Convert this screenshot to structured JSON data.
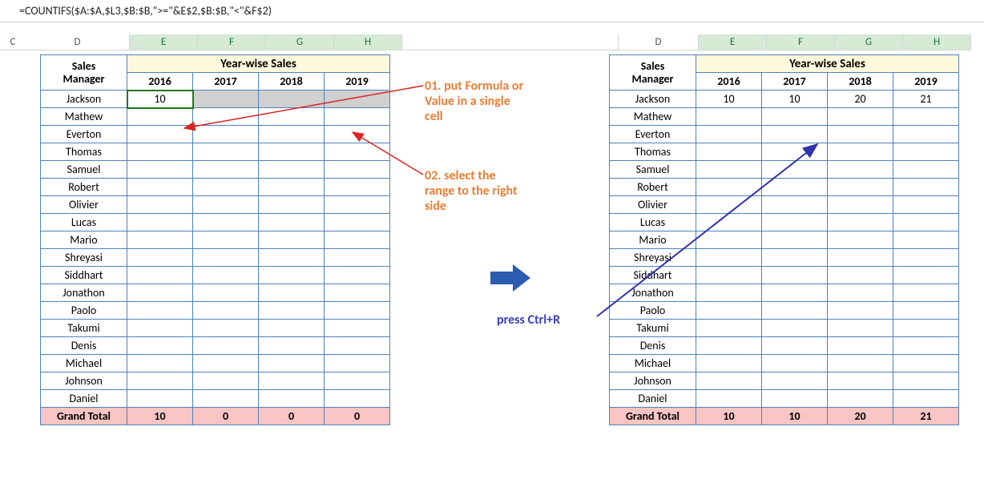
{
  "formula": "=COUNTIFS($A:$A,$L3,$B:$B,\">=\"&E$2,$B:$B,\"<\"&F$2)",
  "colHeaders": {
    "left": [
      "C",
      "D",
      "E",
      "F",
      "G",
      "H"
    ],
    "right": [
      "D",
      "E",
      "F",
      "G",
      "H"
    ]
  },
  "leftTable": {
    "yearHeader": "Year-wise Sales",
    "mgrHeader1": "Sales",
    "mgrHeader2": "Manager",
    "years": [
      "2016",
      "2017",
      "2018",
      "2019"
    ],
    "rows": [
      {
        "name": "Jackson",
        "vals": [
          "10",
          "",
          "",
          ""
        ],
        "selected": true
      },
      {
        "name": "Mathew",
        "vals": [
          "",
          "",
          "",
          ""
        ]
      },
      {
        "name": "Everton",
        "vals": [
          "",
          "",
          "",
          ""
        ]
      },
      {
        "name": "Thomas",
        "vals": [
          "",
          "",
          "",
          ""
        ]
      },
      {
        "name": "Samuel",
        "vals": [
          "",
          "",
          "",
          ""
        ]
      },
      {
        "name": "Robert",
        "vals": [
          "",
          "",
          "",
          ""
        ]
      },
      {
        "name": "Olivier",
        "vals": [
          "",
          "",
          "",
          ""
        ]
      },
      {
        "name": "Lucas",
        "vals": [
          "",
          "",
          "",
          ""
        ]
      },
      {
        "name": "Mario",
        "vals": [
          "",
          "",
          "",
          ""
        ]
      },
      {
        "name": "Shreyasi",
        "vals": [
          "",
          "",
          "",
          ""
        ]
      },
      {
        "name": "Siddhart",
        "vals": [
          "",
          "",
          "",
          ""
        ]
      },
      {
        "name": "Jonathon",
        "vals": [
          "",
          "",
          "",
          ""
        ]
      },
      {
        "name": "Paolo",
        "vals": [
          "",
          "",
          "",
          ""
        ]
      },
      {
        "name": "Takumi",
        "vals": [
          "",
          "",
          "",
          ""
        ]
      },
      {
        "name": "Denis",
        "vals": [
          "",
          "",
          "",
          ""
        ]
      },
      {
        "name": "Michael",
        "vals": [
          "",
          "",
          "",
          ""
        ]
      },
      {
        "name": "Johnson",
        "vals": [
          "",
          "",
          "",
          ""
        ]
      },
      {
        "name": "Daniel",
        "vals": [
          "",
          "",
          "",
          ""
        ]
      }
    ],
    "grandTotal": {
      "label": "Grand Total",
      "vals": [
        "10",
        "0",
        "0",
        "0"
      ]
    }
  },
  "rightTable": {
    "yearHeader": "Year-wise Sales",
    "mgrHeader1": "Sales",
    "mgrHeader2": "Manager",
    "years": [
      "2016",
      "2017",
      "2018",
      "2019"
    ],
    "rows": [
      {
        "name": "Jackson",
        "vals": [
          "10",
          "10",
          "20",
          "21"
        ]
      },
      {
        "name": "Mathew",
        "vals": [
          "",
          "",
          "",
          ""
        ]
      },
      {
        "name": "Everton",
        "vals": [
          "",
          "",
          "",
          ""
        ]
      },
      {
        "name": "Thomas",
        "vals": [
          "",
          "",
          "",
          ""
        ]
      },
      {
        "name": "Samuel",
        "vals": [
          "",
          "",
          "",
          ""
        ]
      },
      {
        "name": "Robert",
        "vals": [
          "",
          "",
          "",
          ""
        ]
      },
      {
        "name": "Olivier",
        "vals": [
          "",
          "",
          "",
          ""
        ]
      },
      {
        "name": "Lucas",
        "vals": [
          "",
          "",
          "",
          ""
        ]
      },
      {
        "name": "Mario",
        "vals": [
          "",
          "",
          "",
          ""
        ]
      },
      {
        "name": "Shreyasi",
        "vals": [
          "",
          "",
          "",
          ""
        ]
      },
      {
        "name": "Siddhart",
        "vals": [
          "",
          "",
          "",
          ""
        ]
      },
      {
        "name": "Jonathon",
        "vals": [
          "",
          "",
          "",
          ""
        ]
      },
      {
        "name": "Paolo",
        "vals": [
          "",
          "",
          "",
          ""
        ]
      },
      {
        "name": "Takumi",
        "vals": [
          "",
          "",
          "",
          ""
        ]
      },
      {
        "name": "Denis",
        "vals": [
          "",
          "",
          "",
          ""
        ]
      },
      {
        "name": "Michael",
        "vals": [
          "",
          "",
          "",
          ""
        ]
      },
      {
        "name": "Johnson",
        "vals": [
          "",
          "",
          "",
          ""
        ]
      },
      {
        "name": "Daniel",
        "vals": [
          "",
          "",
          "",
          ""
        ]
      }
    ],
    "grandTotal": {
      "label": "Grand Total",
      "vals": [
        "10",
        "10",
        "20",
        "21"
      ]
    }
  },
  "annotations": {
    "a01_l1": "01. put Formula or",
    "a01_l2": "Value in a single",
    "a01_l3": "cell",
    "a02_l1": "02. select the",
    "a02_l2": "range to the right",
    "a02_l3": "side",
    "pressCtrlR": "press Ctrl+R"
  }
}
